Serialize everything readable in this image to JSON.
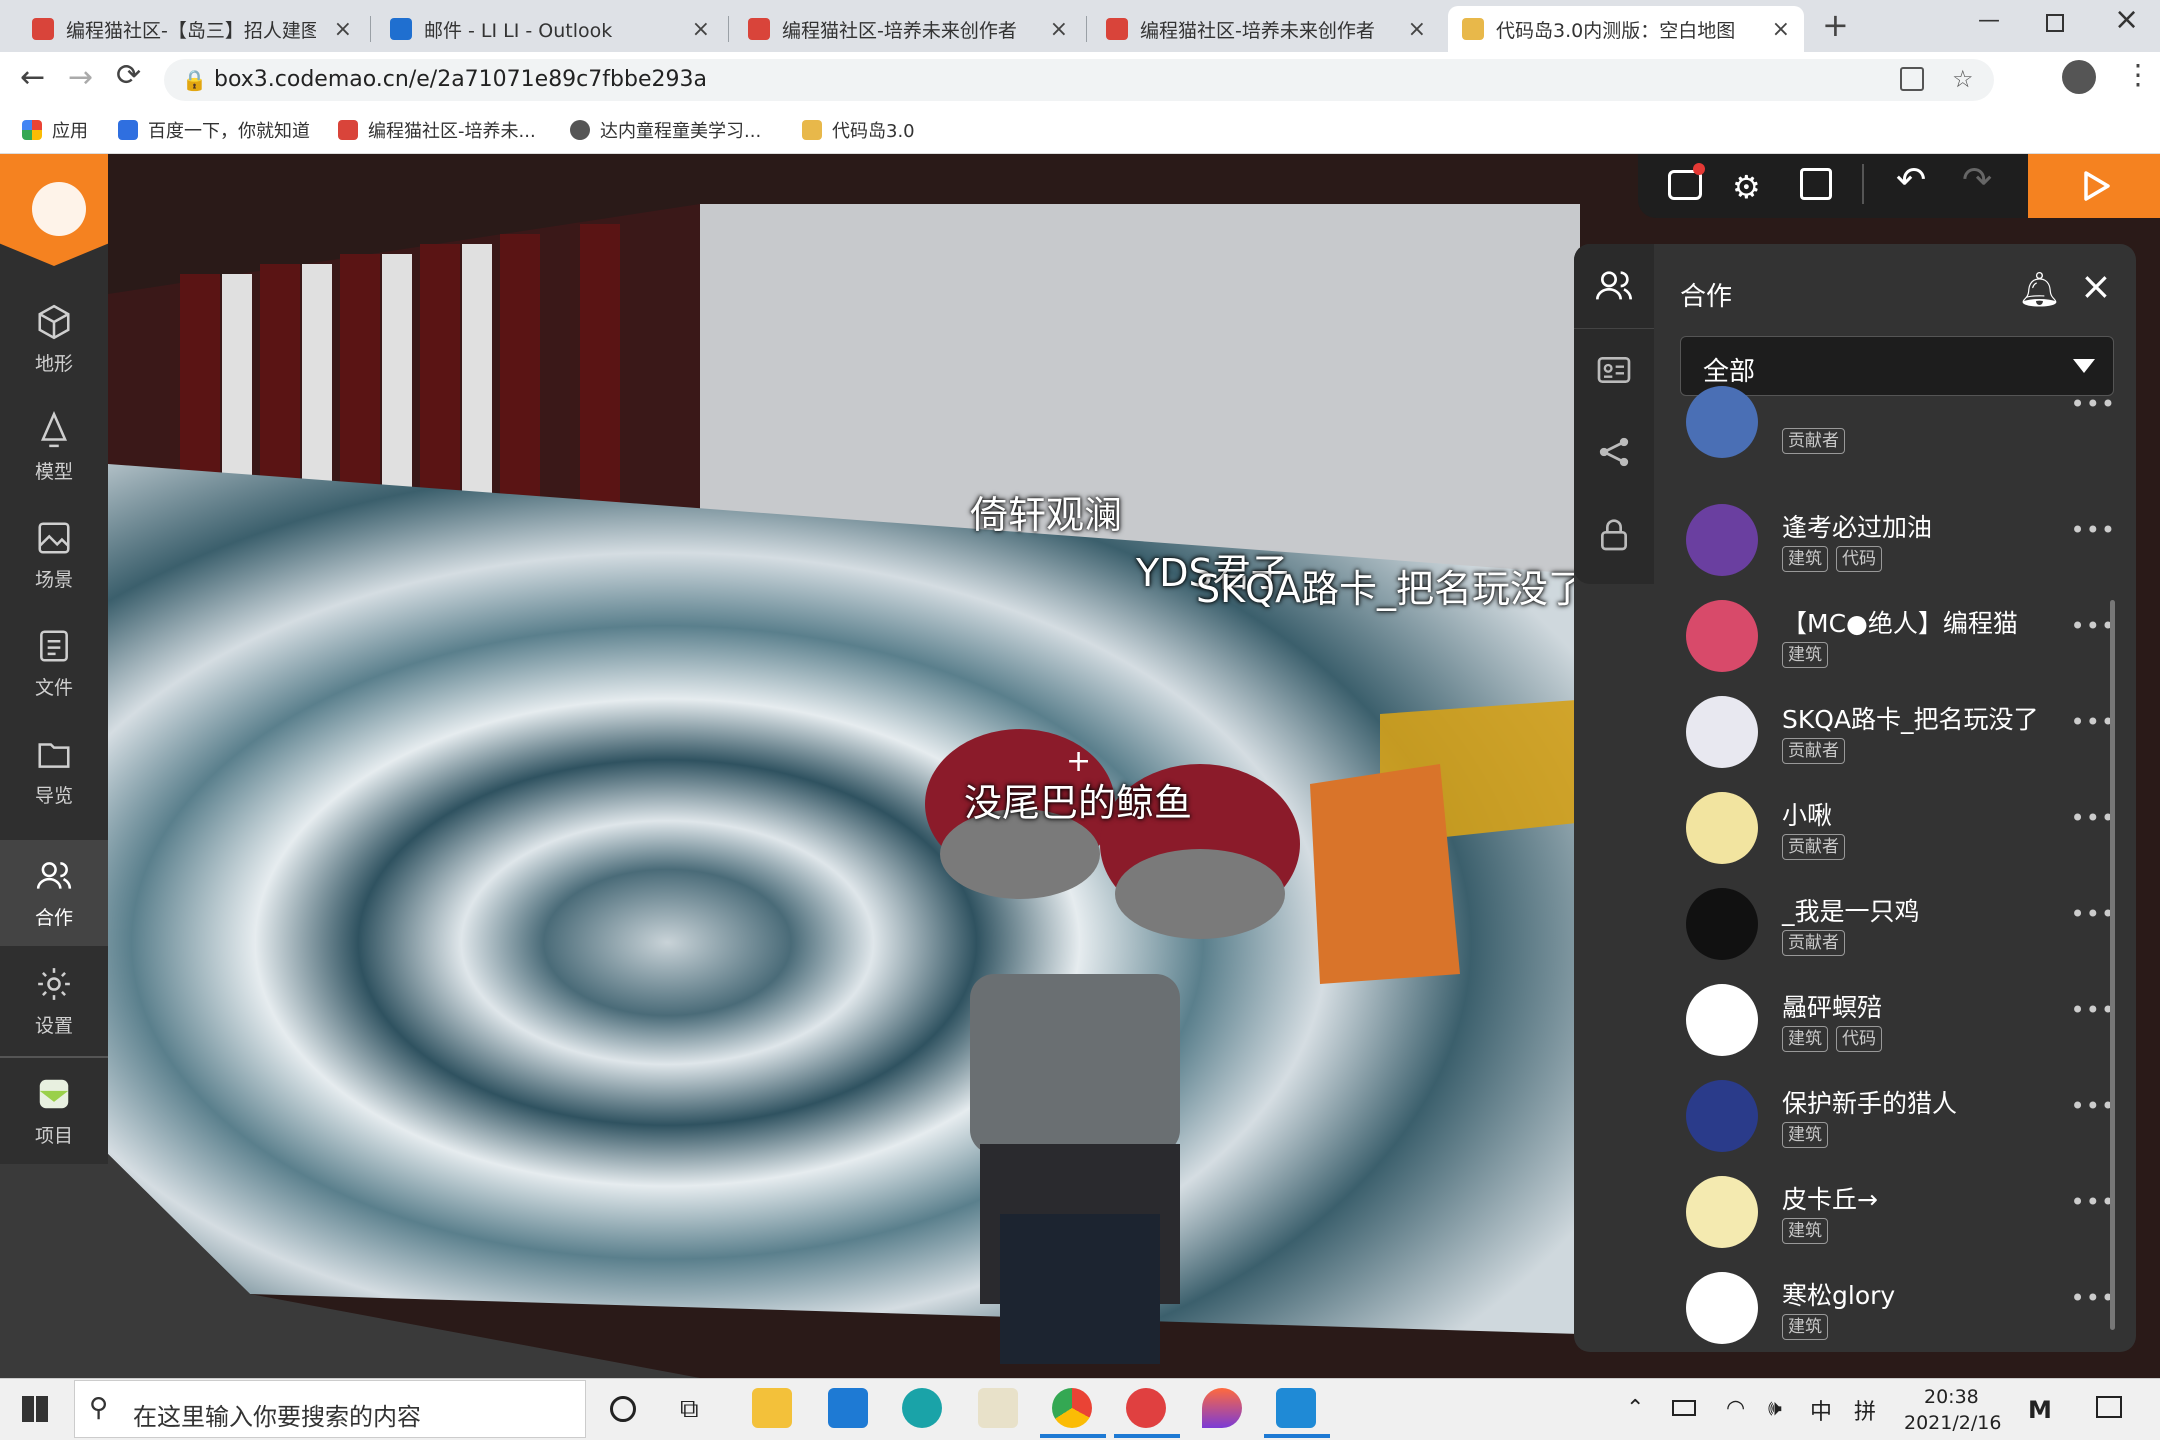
{
  "browser": {
    "tabs": [
      {
        "label": "编程猫社区-【岛三】招人建图了",
        "icon": "codemao-icon",
        "color": "#d9443a"
      },
      {
        "label": "邮件 - LI LI - Outlook",
        "icon": "outlook-icon",
        "color": "#1f6fd0"
      },
      {
        "label": "编程猫社区-培养未来创作者",
        "icon": "codemao-icon",
        "color": "#d9443a"
      },
      {
        "label": "编程猫社区-培养未来创作者",
        "icon": "codemao-icon",
        "color": "#d9443a"
      },
      {
        "label": "代码岛3.0内测版：空白地图",
        "icon": "box3-icon",
        "color": "#e8b84a"
      }
    ],
    "new_tab": "+",
    "url": "box3.codemao.cn/e/2a71071e89c7fbbe293a",
    "bookmarks": [
      {
        "label": "应用",
        "icon": "apps-grid-icon"
      },
      {
        "label": "百度一下，你就知道",
        "icon": "baidu-icon"
      },
      {
        "label": "编程猫社区-培养未...",
        "icon": "codemao-icon"
      },
      {
        "label": "达内童程童美学习...",
        "icon": "globe-icon"
      },
      {
        "label": "代码岛3.0",
        "icon": "box3-icon"
      }
    ]
  },
  "leftnav": [
    {
      "label": "地形",
      "icon": "cube-icon"
    },
    {
      "label": "模型",
      "icon": "model-icon"
    },
    {
      "label": "场景",
      "icon": "image-icon"
    },
    {
      "label": "文件",
      "icon": "file-icon"
    },
    {
      "label": "导览",
      "icon": "folder-icon"
    },
    {
      "label": "合作",
      "icon": "people-icon",
      "active": true
    },
    {
      "label": "设置",
      "icon": "gear-icon"
    },
    {
      "label": "项目",
      "icon": "project-icon"
    }
  ],
  "scene": {
    "labels": [
      "倚轩观澜",
      "YDS君子",
      "SKQA路卡_把名玩没了",
      "没尾巴的鲸鱼"
    ],
    "crosshair": "+"
  },
  "panel": {
    "title": "合作",
    "filter": "全部",
    "members": [
      {
        "name": "",
        "tags": [
          "贡献者"
        ],
        "avatar": "#4a6fb5"
      },
      {
        "name": "逢考必过加油",
        "tags": [
          "建筑",
          "代码"
        ],
        "avatar": "#6a3fa0"
      },
      {
        "name": "【MC●绝人】编程猫",
        "tags": [
          "建筑"
        ],
        "avatar": "#d84a6a"
      },
      {
        "name": "SKQA路卡_把名玩没了",
        "tags": [
          "贡献者"
        ],
        "avatar": "#e8e8f0"
      },
      {
        "name": "小啾",
        "tags": [
          "贡献者"
        ],
        "avatar": "#f2e4a0"
      },
      {
        "name": "_我是一只鸡",
        "tags": [
          "贡献者"
        ],
        "avatar": "#111111"
      },
      {
        "name": "曧砰螟殕",
        "tags": [
          "建筑",
          "代码"
        ],
        "avatar": "#ffffff"
      },
      {
        "name": "保护新手的猎人",
        "tags": [
          "建筑"
        ],
        "avatar": "#2a3b8a"
      },
      {
        "name": "皮卡丘→",
        "tags": [
          "建筑"
        ],
        "avatar": "#f4eab0"
      },
      {
        "name": "寒松glory",
        "tags": [
          "建筑"
        ],
        "avatar": "#ffffff"
      }
    ],
    "more": "•••"
  },
  "taskbar": {
    "search_placeholder": "在这里输入你要搜索的内容",
    "time": "20:38",
    "date": "2021/2/16",
    "ime": "中",
    "ime2": "拼"
  }
}
